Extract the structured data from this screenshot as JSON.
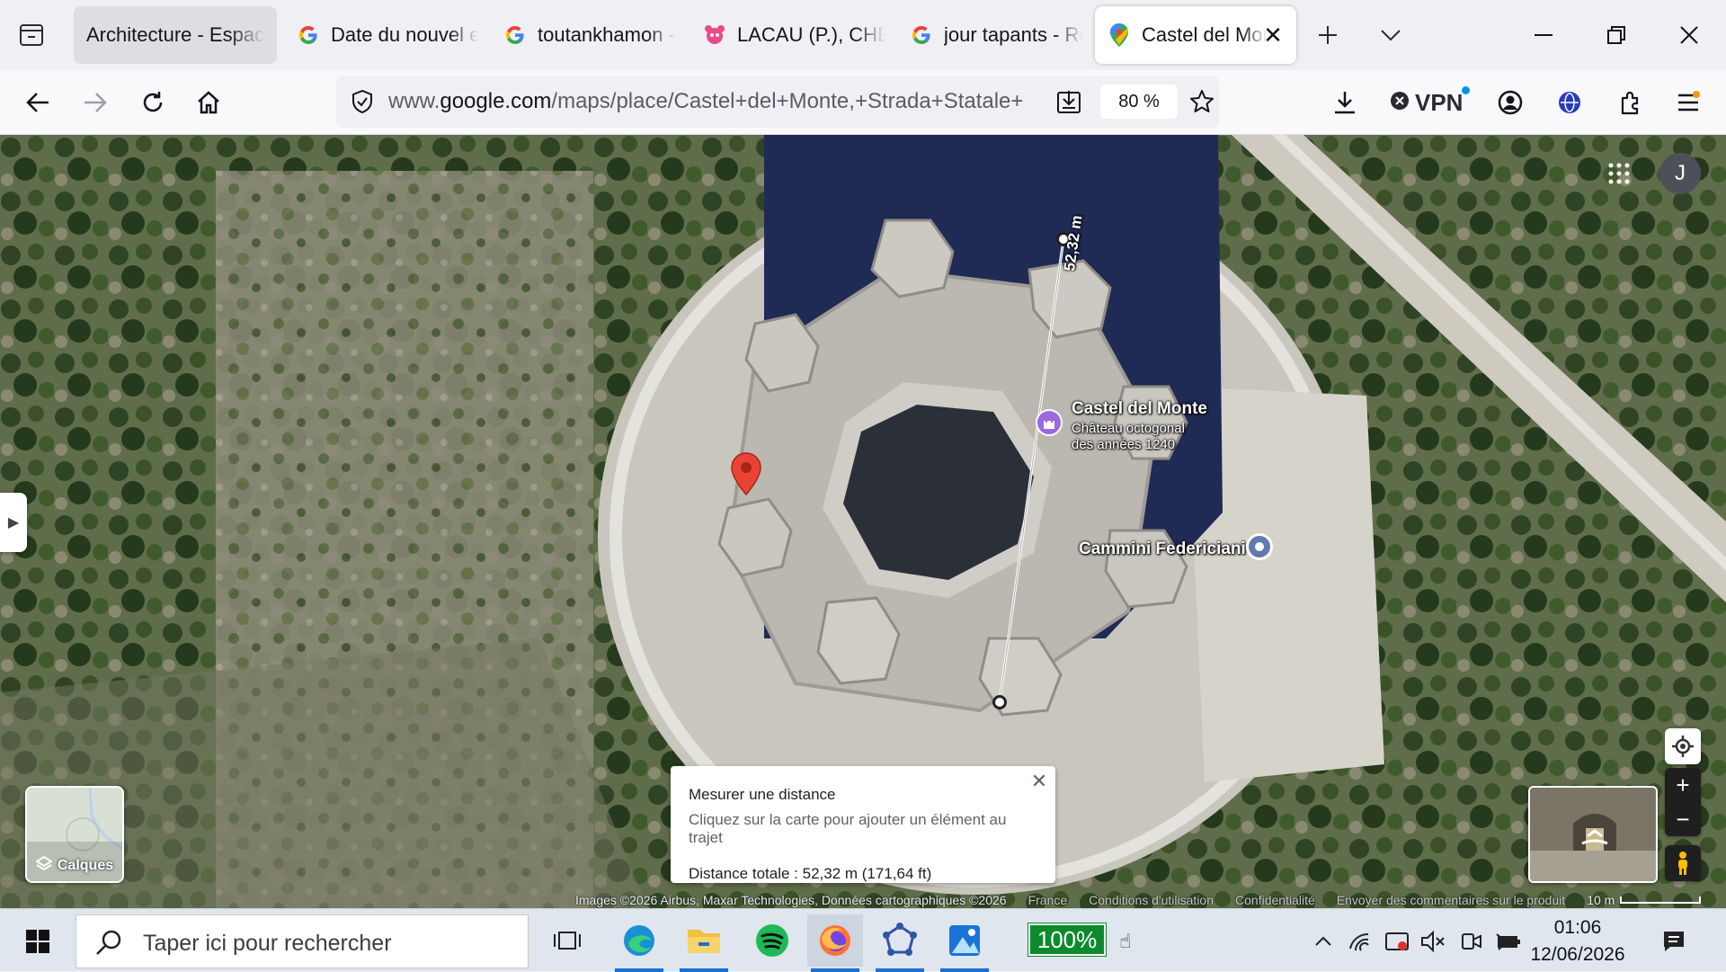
{
  "browser": {
    "tabs": [
      {
        "label": "Architecture - Espace",
        "favicon": "bookmark-icon",
        "state": "highlighted"
      },
      {
        "label": "Date du nouvel e",
        "favicon": "google-icon",
        "state": "normal"
      },
      {
        "label": "toutankhamon -",
        "favicon": "google-icon",
        "state": "normal"
      },
      {
        "label": "LACAU (P.), CHEV",
        "favicon": "site-icon",
        "state": "normal"
      },
      {
        "label": "jour tapants - Re",
        "favicon": "google-icon",
        "state": "normal"
      },
      {
        "label": "Castel del Mon",
        "favicon": "maps-pin-icon",
        "state": "active"
      }
    ],
    "url_prefix": "www.",
    "url_host": "google.com",
    "url_path": "/maps/place/Castel+del+Monte,+Strada+Statale+",
    "zoom": "80 %",
    "vpn_label": "VPN"
  },
  "map": {
    "account_initial": "J",
    "castle_name": "Castel del Monte",
    "castle_desc_line1": "Château octogonal",
    "castle_desc_line2": "des années 1240",
    "second_place": "Cammini Federiciani",
    "measure_label": "52,32 m",
    "layers_label": "Calques",
    "measure_card": {
      "title": "Mesurer une distance",
      "subtitle": "Cliquez sur la carte pour ajouter un élément au trajet",
      "distance": "Distance totale : 52,32 m (171,64 ft)"
    },
    "footer": {
      "imagery": "Images ©2026 Airbus, Maxar Technologies, Données cartographiques ©2026",
      "country": "France",
      "terms": "Conditions d'utilisation",
      "privacy": "Confidentialité",
      "feedback": "Envoyer des commentaires sur le produit",
      "scale": "10 m"
    }
  },
  "taskbar": {
    "search_placeholder": "Taper ici pour rechercher",
    "zoom_badge": "100%",
    "time": "01:06",
    "date": "12/06/2026"
  },
  "colors": {
    "accent_blue": "#1a73e8",
    "pin_red": "#ea4335",
    "castle_pin_purple": "#9c6ade",
    "zoom_green": "#0e8a2e"
  }
}
